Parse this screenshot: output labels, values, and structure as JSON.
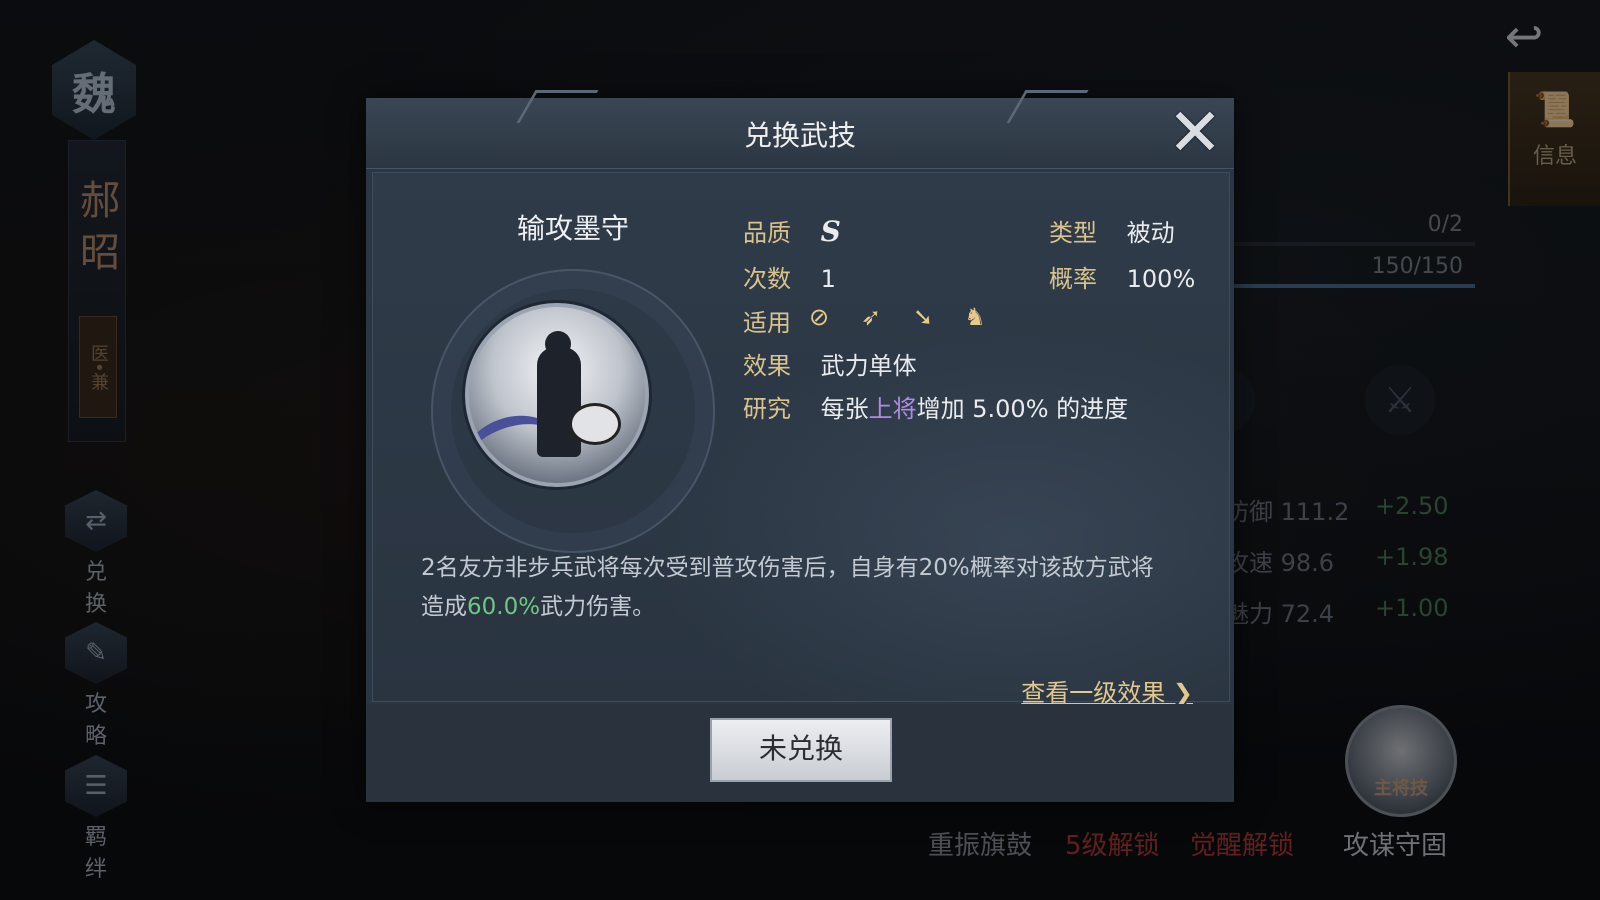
{
  "background": {
    "faction": "魏",
    "hero_name": "郝昭",
    "hero_role": "医•兼",
    "side_buttons": [
      {
        "label": "兑换",
        "icon": "exchange-icon"
      },
      {
        "label": "攻略",
        "icon": "scroll-icon"
      },
      {
        "label": "羁绊",
        "icon": "bond-icon"
      }
    ],
    "info_tab_label": "信息",
    "progress_1": "0/2",
    "progress_2": "150/150",
    "progress_2_fill": 1.0,
    "attributes": [
      {
        "name": "防御",
        "value": "111.2",
        "delta": "+2.50"
      },
      {
        "name": "攻速",
        "value": "98.6",
        "delta": "+1.98"
      },
      {
        "name": "魅力",
        "value": "72.4",
        "delta": "+1.00"
      }
    ],
    "bottom_skills": [
      {
        "label": "重振旗鼓",
        "color": "#8b929c"
      },
      {
        "label": "5级解锁",
        "color": "#b23a3a"
      },
      {
        "label": "觉醒解锁",
        "color": "#b23a3a"
      },
      {
        "label": "攻谋守固",
        "color": "#c8ccd2"
      }
    ],
    "main_skill_tag": "主将技"
  },
  "modal": {
    "title": "兑换武技",
    "skill_name": "输攻墨守",
    "quality_label": "品质",
    "quality_value": "S",
    "type_label": "类型",
    "type_value": "被动",
    "count_label": "次数",
    "count_value": "1",
    "rate_label": "概率",
    "rate_value": "100%",
    "applicable_label": "适用",
    "applicable_icons": [
      "shield-troop-icon",
      "bow-troop-icon",
      "spear-troop-icon",
      "cavalry-troop-icon"
    ],
    "effect_label": "效果",
    "effect_value": "武力单体",
    "research_label": "研究",
    "research_prefix": "每张",
    "research_highlight": "上将",
    "research_suffix": "增加 5.00% 的进度",
    "description_part1": "2名友方非步兵武将每次受到普攻伤害后，自身有20%概率对该敌方武将造成",
    "description_highlight": "60.0%",
    "description_part2": "武力伤害。",
    "view_link": "查看一级效果",
    "button_label": "未兑换"
  }
}
